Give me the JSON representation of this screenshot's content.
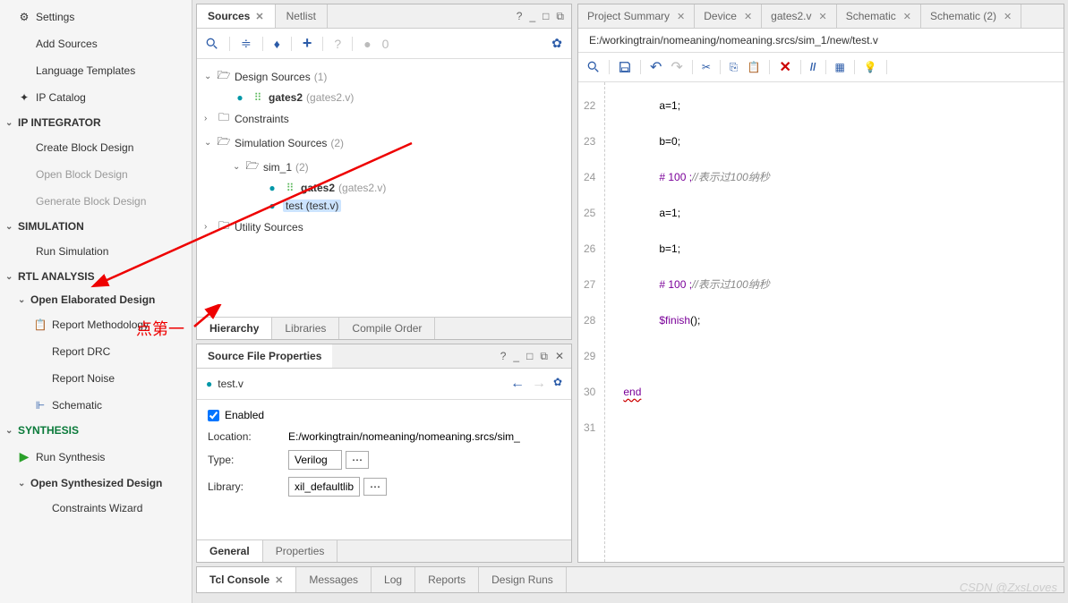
{
  "nav": {
    "settings": "Settings",
    "add_sources": "Add Sources",
    "lang_templates": "Language Templates",
    "ip_catalog": "IP Catalog",
    "ip_integrator": "IP INTEGRATOR",
    "create_block": "Create Block Design",
    "open_block": "Open Block Design",
    "generate_block": "Generate Block Design",
    "simulation": "SIMULATION",
    "run_simulation": "Run Simulation",
    "rtl_analysis": "RTL ANALYSIS",
    "open_elaborated": "Open Elaborated Design",
    "report_methodology": "Report Methodology",
    "report_drc": "Report DRC",
    "report_noise": "Report Noise",
    "schematic": "Schematic",
    "synthesis": "SYNTHESIS",
    "run_synthesis": "Run Synthesis",
    "open_synthesized": "Open Synthesized Design",
    "constraints_wizard": "Constraints Wizard"
  },
  "sources": {
    "tab_sources": "Sources",
    "tab_netlist": "Netlist",
    "breadcrumb_zero": "0",
    "design_sources": "Design Sources",
    "design_sources_count": "(1)",
    "gates2": "gates2",
    "gates2_file": "(gates2.v)",
    "constraints": "Constraints",
    "sim_sources": "Simulation Sources",
    "sim_sources_count": "(2)",
    "sim_1": "sim_1",
    "sim_1_count": "(2)",
    "test": "test (test.v)",
    "utility_sources": "Utility Sources",
    "btab_hierarchy": "Hierarchy",
    "btab_libraries": "Libraries",
    "btab_compile": "Compile Order"
  },
  "props": {
    "title": "Source File Properties",
    "filename": "test.v",
    "enabled_label": "Enabled",
    "location_label": "Location:",
    "location_value": "E:/workingtrain/nomeaning/nomeaning.srcs/sim_",
    "type_label": "Type:",
    "type_value": "Verilog",
    "library_label": "Library:",
    "library_value": "xil_defaultlib",
    "tab_general": "General",
    "tab_properties": "Properties"
  },
  "editor": {
    "tabs": {
      "summary": "Project Summary",
      "device": "Device",
      "gates2": "gates2.v",
      "schematic": "Schematic",
      "schematic2": "Schematic (2)"
    },
    "path": "E:/workingtrain/nomeaning/nomeaning.srcs/sim_1/new/test.v",
    "lines": {
      "22": {
        "n": "22",
        "t": "a=1;"
      },
      "23": {
        "n": "23",
        "t": "b=0;"
      },
      "24": {
        "n": "24",
        "a": "# 100 ;",
        "c": "//表示过100纳秒"
      },
      "25": {
        "n": "25",
        "t": "a=1;"
      },
      "26": {
        "n": "26",
        "t": "b=1;"
      },
      "27": {
        "n": "27",
        "a": "# 100 ;",
        "c": "//表示过100纳秒"
      },
      "28": {
        "n": "28",
        "f": "$finish",
        "p": "();"
      },
      "29": {
        "n": "29",
        "t": ""
      },
      "30": {
        "n": "30",
        "e": "end"
      },
      "31": {
        "n": "31",
        "t": ""
      }
    }
  },
  "console": {
    "tcl": "Tcl Console",
    "messages": "Messages",
    "log": "Log",
    "reports": "Reports",
    "runs": "Design Runs"
  },
  "annotation": "点第一",
  "watermark": "CSDN @ZxsLoves"
}
